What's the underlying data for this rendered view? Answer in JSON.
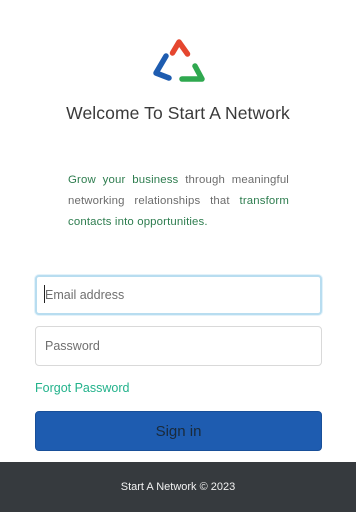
{
  "brand": {
    "logo_icon": "triangle-network-logo-icon",
    "colors": {
      "red": "#e5462f",
      "blue": "#1e5cb0",
      "green": "#2fa84f"
    }
  },
  "welcome_title": "Welcome To Start A Network",
  "tagline": {
    "part1": "Grow your business",
    "part2": " through meaningful networking relationships that ",
    "part3": "transform contacts into opportunities."
  },
  "form": {
    "email_placeholder": "Email address",
    "password_placeholder": "Password",
    "forgot_label": "Forgot Password",
    "signin_label": "Sign in"
  },
  "footer": {
    "text": "Start A Network © 2023"
  }
}
